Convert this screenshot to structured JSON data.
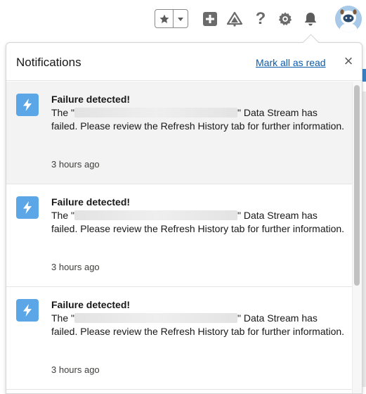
{
  "topbar": {
    "favorites_icon": "star-icon",
    "favorites_dropdown_icon": "caret-down-icon",
    "global_actions_icon": "plus-square-icon",
    "trailhead_icon": "trailhead-icon",
    "help_icon": "question-icon",
    "help_glyph": "?",
    "setup_icon": "gear-icon",
    "notifications_icon": "bell-icon",
    "avatar_icon": "astro-avatar-icon"
  },
  "panel": {
    "title": "Notifications",
    "mark_all_label": "Mark all as read",
    "close_glyph": "×",
    "close_icon": "close-icon"
  },
  "notifications": [
    {
      "title": "Failure detected!",
      "text_before": "The \"",
      "text_after": "\" Data Stream has failed. Please review the Refresh History tab for further information.",
      "time": "3 hours ago",
      "icon": "lightning-icon",
      "unread": true
    },
    {
      "title": "Failure detected!",
      "text_before": "The \"",
      "text_after": "\" Data Stream has failed. Please review the Refresh History tab for further information.",
      "time": "3 hours ago",
      "icon": "lightning-icon",
      "unread": false
    },
    {
      "title": "Failure detected!",
      "text_before": "The \"",
      "text_after": "\" Data Stream has failed. Please review the Refresh History tab for further information.",
      "time": "3 hours ago",
      "icon": "lightning-icon",
      "unread": false
    }
  ],
  "colors": {
    "link": "#0b5cab",
    "notification_icon_bg": "#5aa6e6",
    "unread_bg": "#f3f3f3"
  }
}
